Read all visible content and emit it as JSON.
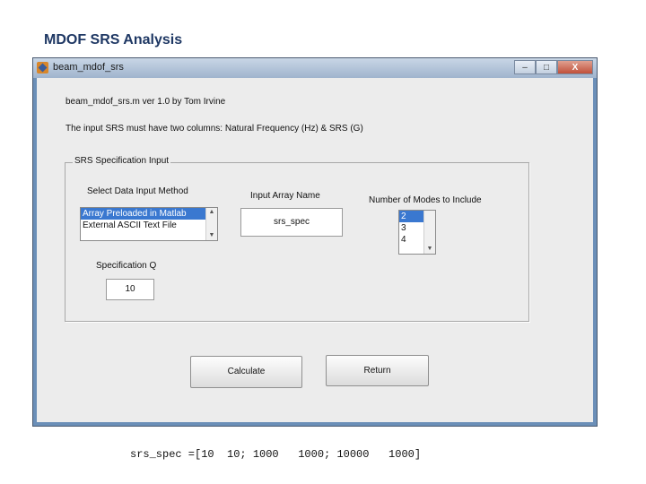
{
  "slide": {
    "title": "MDOF SRS Analysis",
    "caption": "srs_spec =[10  10; 1000   1000; 10000   1000]"
  },
  "window": {
    "title": "beam_mdof_srs",
    "controls": {
      "minimize": "–",
      "maximize": "□",
      "close": "X"
    }
  },
  "header": {
    "version_line": "beam_mdof_srs.m  ver 1.0  by Tom Irvine",
    "instruction": "The input SRS must have two columns:  Natural Frequency (Hz) & SRS (G)"
  },
  "group": {
    "label": "SRS Specification Input",
    "input_method": {
      "label": "Select Data Input Method",
      "options": [
        "Array Preloaded in Matlab",
        "External ASCII Text File"
      ],
      "selected": "Array Preloaded in Matlab"
    },
    "array_name": {
      "label": "Input Array Name",
      "value": "srs_spec"
    },
    "modes": {
      "label": "Number of Modes to Include",
      "options": [
        "2",
        "3",
        "4"
      ],
      "selected": "2"
    },
    "q": {
      "label": "Specification Q",
      "value": "10"
    }
  },
  "buttons": {
    "calculate": "Calculate",
    "return": "Return"
  },
  "icons": {
    "scroll_up": "triangle-up-icon",
    "scroll_down": "triangle-down-icon",
    "app": "matlab-icon"
  }
}
